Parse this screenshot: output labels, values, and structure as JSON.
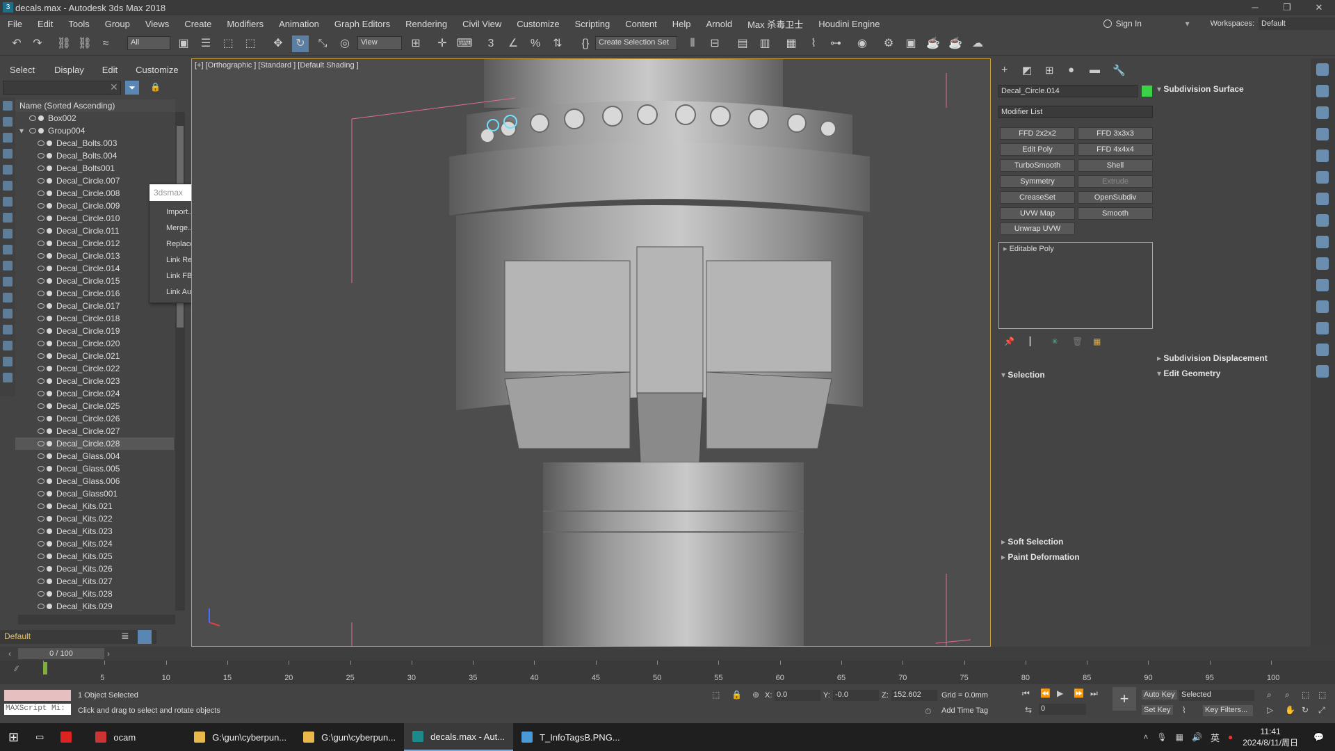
{
  "window": {
    "title": "decals.max - Autodesk 3ds Max 2018",
    "icon_text": "3",
    "min": "─",
    "max": "❐",
    "close": "✕"
  },
  "menu": [
    "File",
    "Edit",
    "Tools",
    "Group",
    "Views",
    "Create",
    "Modifiers",
    "Animation",
    "Graph Editors",
    "Rendering",
    "Civil View",
    "Customize",
    "Scripting",
    "Content",
    "Help",
    "Arnold",
    "Max 杀毒卫士",
    "Houdini Engine"
  ],
  "menu_right": {
    "signin": "Sign In",
    "workspaces_label": "Workspaces:",
    "workspace": "Default"
  },
  "toolbar": {
    "filter": "All",
    "view": "View",
    "create_selection": "Create Selection Set"
  },
  "scene_explorer": {
    "tabs": [
      "Select",
      "Display",
      "Edit",
      "Customize"
    ],
    "column_header": "Name (Sorted Ascending)",
    "objects": [
      {
        "name": "Box002",
        "level": 0
      },
      {
        "name": "Group004",
        "level": 0
      },
      {
        "name": "Decal_Bolts.003",
        "level": 1
      },
      {
        "name": "Decal_Bolts.004",
        "level": 1
      },
      {
        "name": "Decal_Bolts001",
        "level": 1
      },
      {
        "name": "Decal_Circle.007",
        "level": 1
      },
      {
        "name": "Decal_Circle.008",
        "level": 1
      },
      {
        "name": "Decal_Circle.009",
        "level": 1
      },
      {
        "name": "Decal_Circle.010",
        "level": 1
      },
      {
        "name": "Decal_Circle.011",
        "level": 1
      },
      {
        "name": "Decal_Circle.012",
        "level": 1
      },
      {
        "name": "Decal_Circle.013",
        "level": 1
      },
      {
        "name": "Decal_Circle.014",
        "level": 1
      },
      {
        "name": "Decal_Circle.015",
        "level": 1
      },
      {
        "name": "Decal_Circle.016",
        "level": 1
      },
      {
        "name": "Decal_Circle.017",
        "level": 1
      },
      {
        "name": "Decal_Circle.018",
        "level": 1
      },
      {
        "name": "Decal_Circle.019",
        "level": 1
      },
      {
        "name": "Decal_Circle.020",
        "level": 1
      },
      {
        "name": "Decal_Circle.021",
        "level": 1
      },
      {
        "name": "Decal_Circle.022",
        "level": 1
      },
      {
        "name": "Decal_Circle.023",
        "level": 1
      },
      {
        "name": "Decal_Circle.024",
        "level": 1
      },
      {
        "name": "Decal_Circle.025",
        "level": 1
      },
      {
        "name": "Decal_Circle.026",
        "level": 1
      },
      {
        "name": "Decal_Circle.027",
        "level": 1
      },
      {
        "name": "Decal_Circle.028",
        "level": 1
      },
      {
        "name": "Decal_Glass.004",
        "level": 1
      },
      {
        "name": "Decal_Glass.005",
        "level": 1
      },
      {
        "name": "Decal_Glass.006",
        "level": 1
      },
      {
        "name": "Decal_Glass001",
        "level": 1
      },
      {
        "name": "Decal_Kits.021",
        "level": 1
      },
      {
        "name": "Decal_Kits.022",
        "level": 1
      },
      {
        "name": "Decal_Kits.023",
        "level": 1
      },
      {
        "name": "Decal_Kits.024",
        "level": 1
      },
      {
        "name": "Decal_Kits.025",
        "level": 1
      },
      {
        "name": "Decal_Kits.026",
        "level": 1
      },
      {
        "name": "Decal_Kits.027",
        "level": 1
      },
      {
        "name": "Decal_Kits.028",
        "level": 1
      },
      {
        "name": "Decal_Kits.029",
        "level": 1
      }
    ],
    "selected": "Decal_Circle.028",
    "layer": "Default"
  },
  "context_menu": {
    "title": "3dsmax",
    "items": [
      "Import...",
      "Merge...",
      "Replace...",
      "Link Revit",
      "Link FBX",
      "Link AutoCAD"
    ]
  },
  "viewport": {
    "label": "[+] [Orthographic ] [Standard ] [Default Shading ]"
  },
  "command_panel": {
    "object_name": "Decal_Circle.014",
    "object_color": "#3bd24a",
    "modifier_list": "Modifier List",
    "buttons": [
      "FFD 2x2x2",
      "FFD 3x3x3",
      "Edit Poly",
      "FFD 4x4x4",
      "TurboSmooth",
      "Shell",
      "Symmetry",
      "Extrude",
      "CreaseSet",
      "OpenSubdiv",
      "UVW Map",
      "Smooth",
      "Unwrap UVW"
    ],
    "disabled_buttons": [
      "Extrude"
    ],
    "stack": [
      "Editable Poly"
    ],
    "rollouts_left": [
      "Selection",
      "Soft Selection",
      "Paint Deformation"
    ],
    "rollouts_right": [
      "Subdivision Surface",
      "Subdivision Displacement",
      "Edit Geometry"
    ]
  },
  "timeline": {
    "frame": "0 / 100",
    "ticks": [
      0,
      5,
      10,
      15,
      20,
      25,
      30,
      35,
      40,
      45,
      50,
      55,
      60,
      65,
      70,
      75,
      80,
      85,
      90,
      95,
      100
    ]
  },
  "status": {
    "maxscript": "MAXScript Mi:",
    "selected": "1 Object Selected",
    "prompt": "Click and drag to select and rotate objects",
    "x_label": "X:",
    "x": "0.0",
    "y_label": "Y:",
    "y": "-0.0",
    "z_label": "Z:",
    "z": "152.602",
    "grid": "Grid = 0.0mm",
    "add_time_tag": "Add Time Tag",
    "auto_key": "Auto Key",
    "set_key": "Set Key",
    "key_mode": "Selected",
    "key_filters": "Key Filters...",
    "frame_field": "0"
  },
  "taskbar": {
    "items": [
      "ocam",
      "G:\\gun\\cyberpun...",
      "G:\\gun\\cyberpun...",
      "decals.max - Aut...",
      "T_InfoTagsB.PNG..."
    ],
    "active": "decals.max - Aut...",
    "time": "11:41",
    "date": "2024/8/11/周日",
    "ime": "英"
  }
}
